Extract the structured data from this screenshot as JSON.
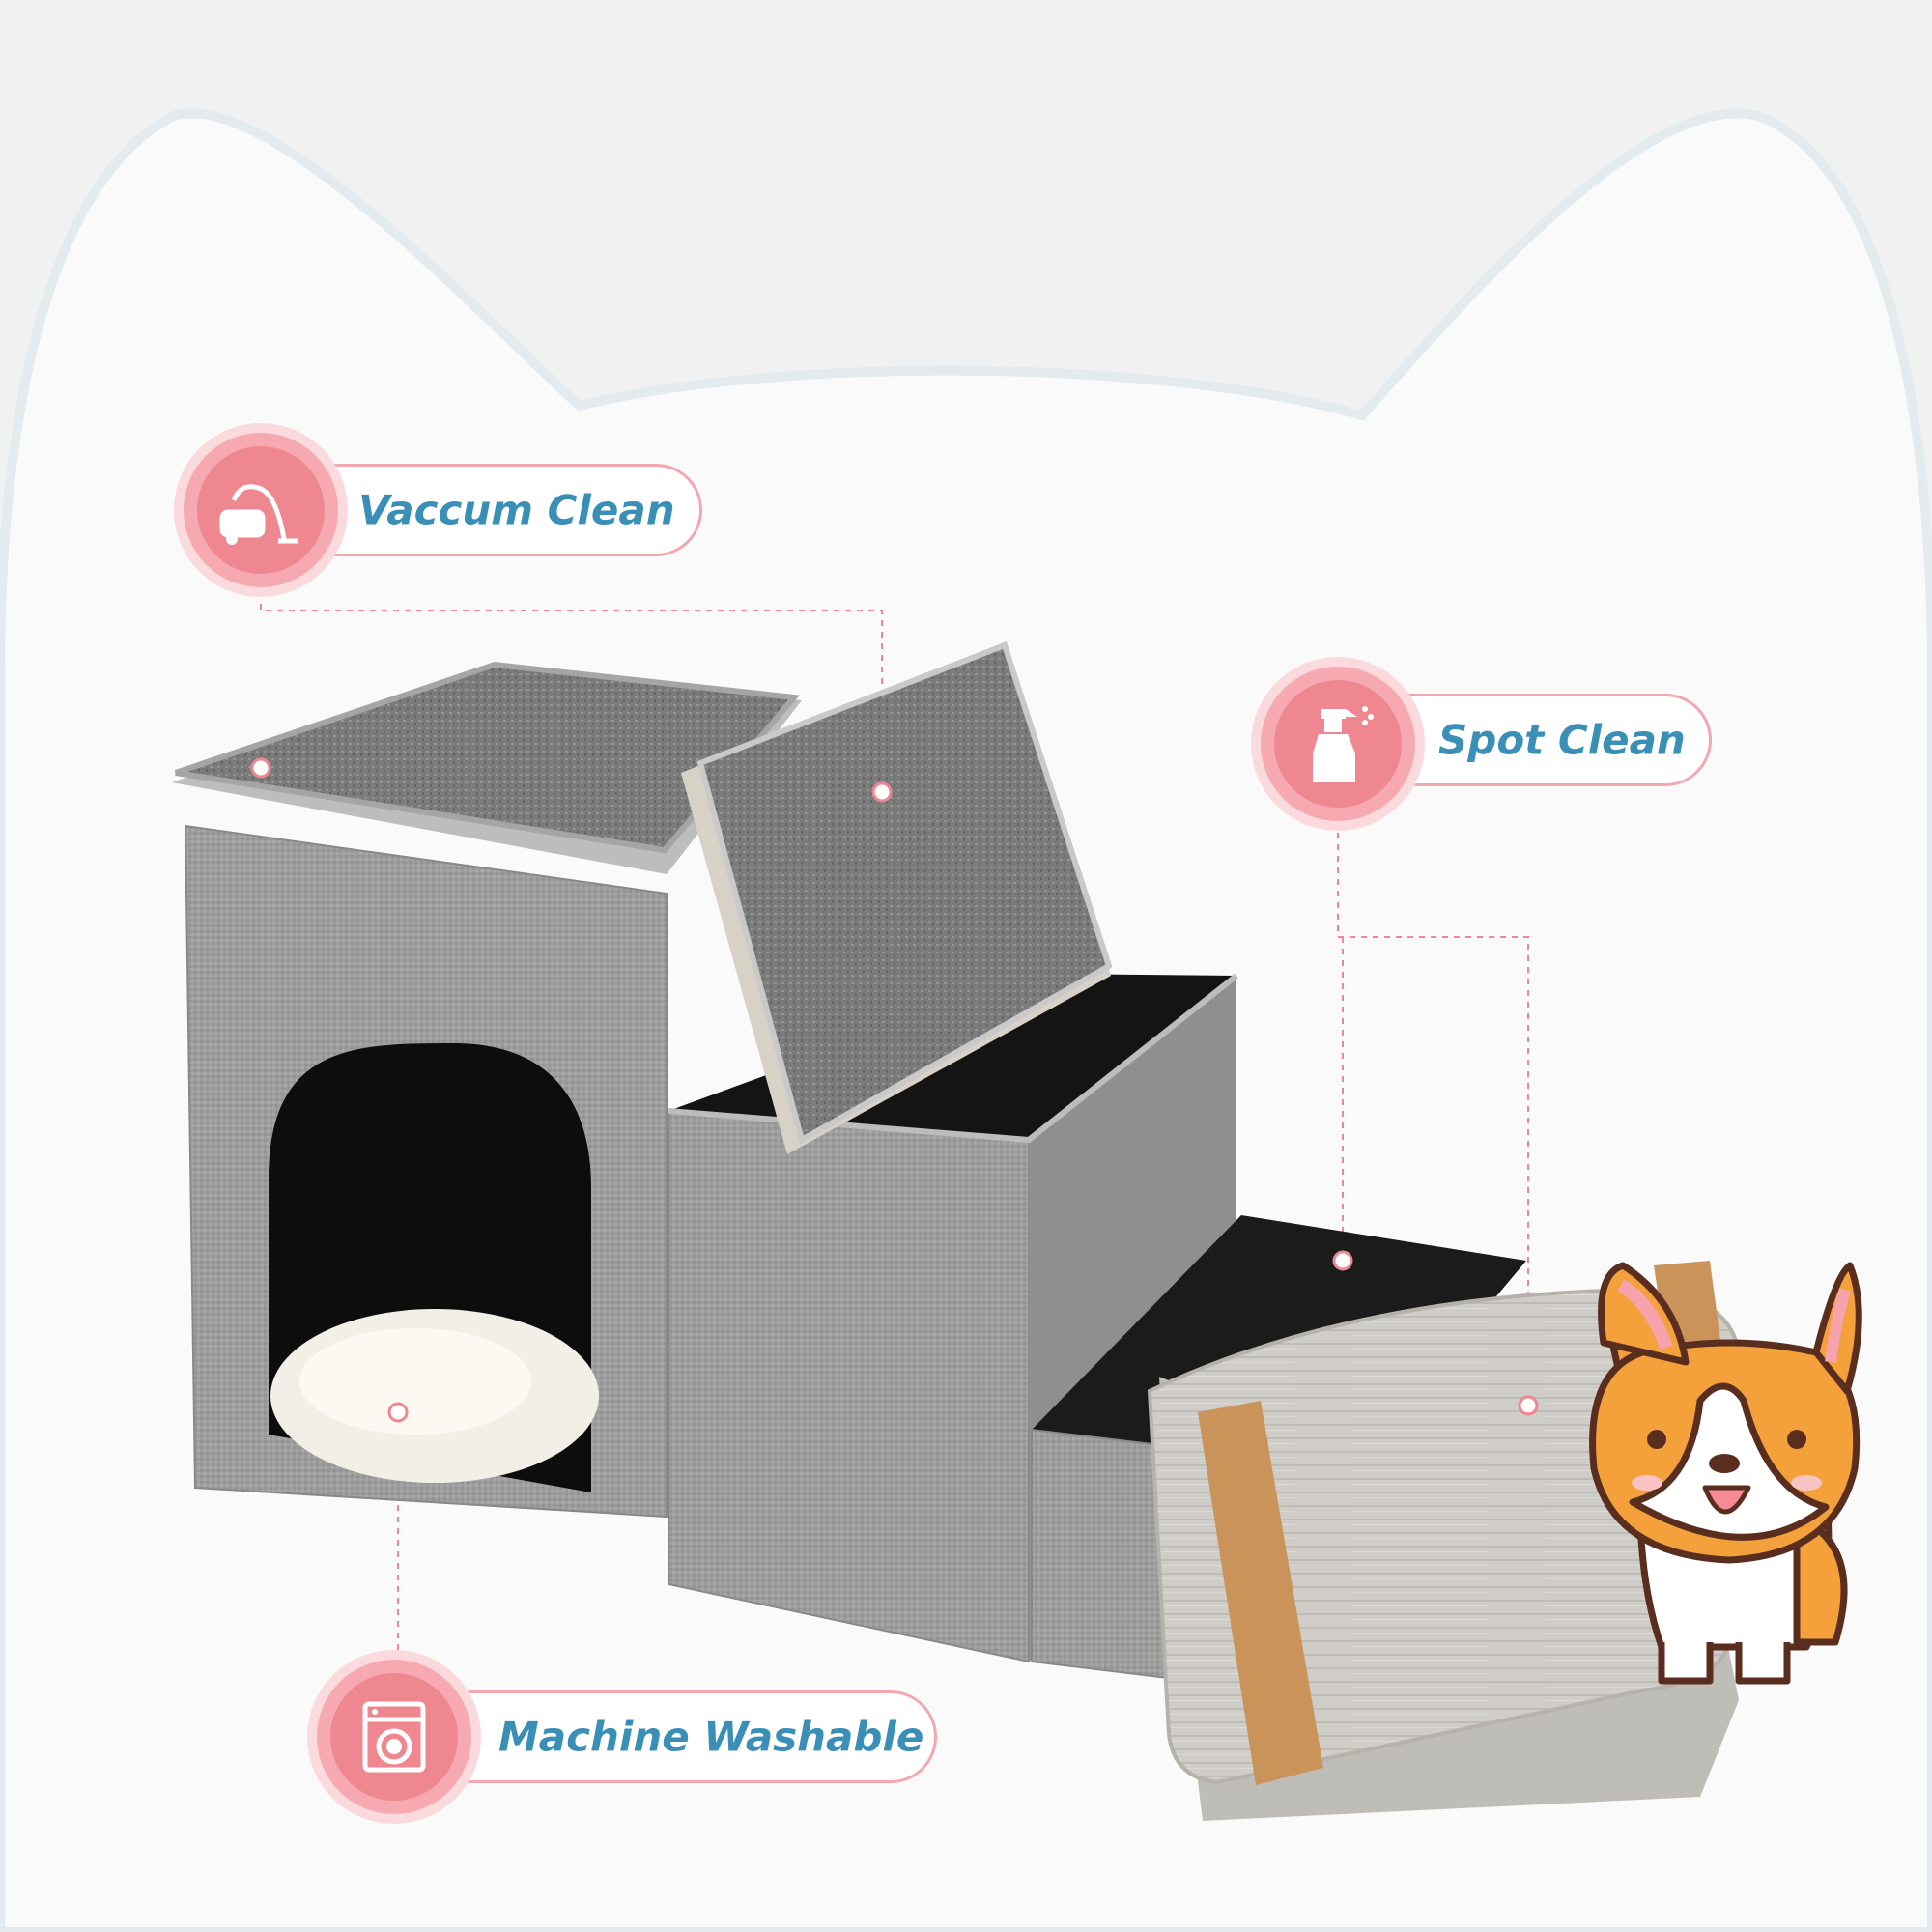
{
  "callouts": {
    "vacuum": {
      "label": "Vaccum Clean",
      "icon": "vacuum-cleaner-icon"
    },
    "spot": {
      "label": "Spot Clean",
      "icon": "spray-bottle-icon"
    },
    "machine": {
      "label": "Machine Washable",
      "icon": "washing-machine-icon"
    }
  },
  "colors": {
    "background": "#f1f1f2",
    "cat_silhouette": "#fafafa",
    "badge_pink": "#ef8790",
    "label_blue": "#3a8fb7",
    "leader_line": "#ef8790",
    "fabric_gray": "#9c9c9c",
    "corgi_orange": "#f4a13b"
  }
}
